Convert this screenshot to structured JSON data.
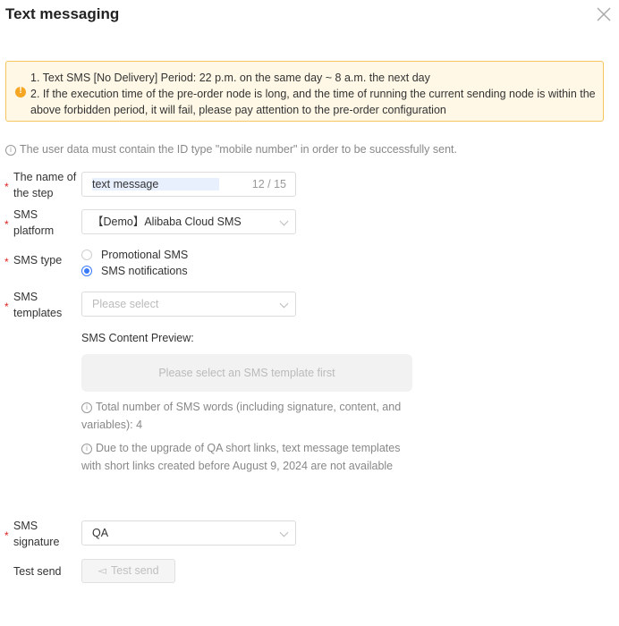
{
  "dialog": {
    "title": "Text messaging",
    "close_icon": "close-icon"
  },
  "alert": {
    "line1": "1. Text SMS [No Delivery] Period: 22 p.m. on the same day ~ 8 a.m. the next day",
    "line2": "2. If the execution time of the pre-order node is long, and the time of running the current sending node is within the above forbidden period, it will fail, please pay attention to the pre-order configuration"
  },
  "info_note": "The user data must contain the ID type \"mobile number\" in order to be successfully sent.",
  "form": {
    "step_name": {
      "label": "The name of the step",
      "value": "text message",
      "counter": "12 / 15"
    },
    "platform": {
      "label": "SMS platform",
      "value": "【Demo】Alibaba Cloud SMS"
    },
    "sms_type": {
      "label": "SMS type",
      "options": [
        "Promotional SMS",
        "SMS notifications"
      ],
      "selected": "SMS notifications"
    },
    "templates": {
      "label": "SMS templates",
      "placeholder": "Please select"
    },
    "preview": {
      "label": "SMS Content Preview:",
      "placeholder": "Please select an SMS template first",
      "word_count_note": "Total number of SMS words (including signature, content, and variables): 4",
      "qa_note": "Due to the upgrade of QA short links, text message templates with short links created before August 9, 2024 are not available"
    },
    "signature": {
      "label": "SMS signature",
      "value": "QA"
    },
    "test_send": {
      "label": "Test send",
      "button_label": "Test send"
    }
  },
  "colors": {
    "accent": "#3a7afe",
    "warning": "#f5a623",
    "required": "#e02020"
  }
}
